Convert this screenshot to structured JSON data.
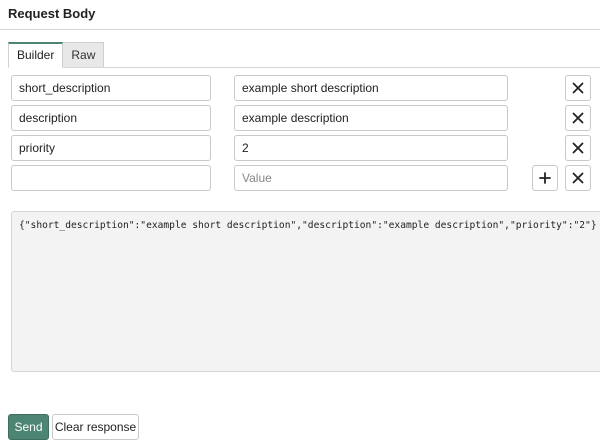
{
  "section": {
    "title": "Request Body"
  },
  "tabs": [
    {
      "label": "Builder",
      "active": true
    },
    {
      "label": "Raw",
      "active": false
    }
  ],
  "rows": [
    {
      "key": "short_description",
      "value": "example short description"
    },
    {
      "key": "description",
      "value": "example description"
    },
    {
      "key": "priority",
      "value": "2"
    },
    {
      "key": "",
      "value": "",
      "value_placeholder": "Value"
    }
  ],
  "body_json": "{\"short_description\":\"example short description\",\"description\":\"example description\",\"priority\":\"2\"}",
  "actions": {
    "send_label": "Send",
    "clear_label": "Clear response"
  },
  "colors": {
    "accent": "#4c8573",
    "body_bg": "#f3f3f3"
  },
  "icons": {
    "delete": "close-icon",
    "add": "plus-icon"
  }
}
